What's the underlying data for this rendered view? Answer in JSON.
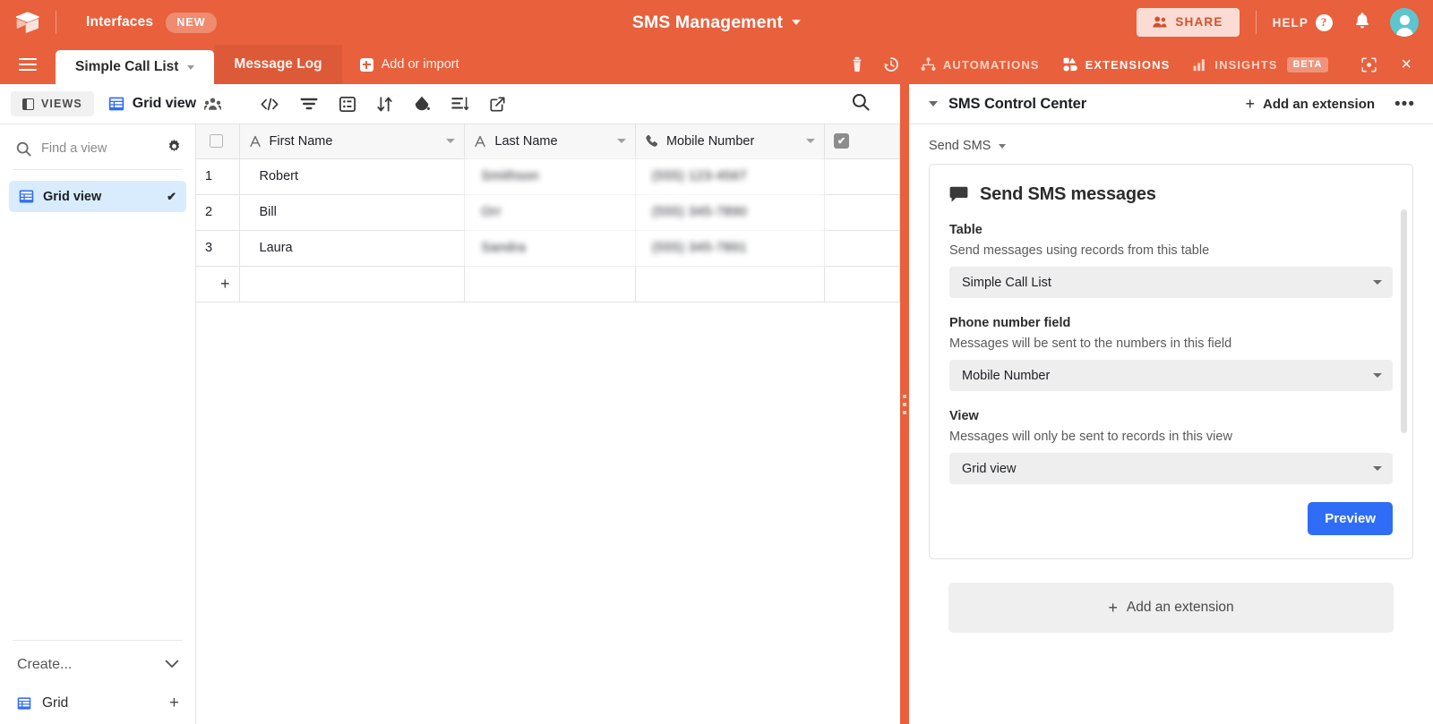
{
  "header": {
    "logo_icon": "airtable-logo-icon",
    "interfaces_label": "Interfaces",
    "new_badge": "NEW",
    "base_title": "SMS Management",
    "share_label": "SHARE",
    "share_icon": "people-share-icon",
    "help_label": "HELP",
    "help_icon": "question-circle-icon",
    "bell_icon": "notification-bell-icon",
    "avatar_icon": "user-avatar-icon",
    "brand_color": "#e8603c"
  },
  "tabs": {
    "menu_icon": "hamburger-menu-icon",
    "items": [
      {
        "label": "Simple Call List",
        "active": true
      },
      {
        "label": "Message Log",
        "active": false
      }
    ],
    "add_label": "Add or import",
    "right_icons": [
      {
        "name": "trash-icon"
      },
      {
        "name": "history-clock-icon"
      }
    ],
    "right_items": [
      {
        "label": "AUTOMATIONS",
        "icon": "automations-icon",
        "active": false
      },
      {
        "label": "EXTENSIONS",
        "icon": "extensions-blocks-icon",
        "active": true
      },
      {
        "label": "INSIGHTS",
        "icon": "insights-bar-icon",
        "active": false,
        "badge": "BETA"
      }
    ],
    "expand_icon": "expand-fullscreen-icon",
    "close_icon": "close-x-icon"
  },
  "viewbar": {
    "views_label": "VIEWS",
    "views_icon": "side-panel-icon",
    "current_view": "Grid view",
    "current_view_icon": "grid-view-icon",
    "collaborators_icon": "collaborators-icon",
    "tools": [
      {
        "name": "embed-code-icon"
      },
      {
        "name": "filter-icon"
      },
      {
        "name": "group-icon"
      },
      {
        "name": "sort-icon"
      },
      {
        "name": "color-fill-icon"
      },
      {
        "name": "row-height-icon"
      },
      {
        "name": "share-view-icon"
      }
    ],
    "search_icon": "search-icon"
  },
  "view_sidebar": {
    "search_placeholder": "Find a view",
    "search_icon": "search-icon",
    "gear_icon": "gear-icon",
    "views": [
      {
        "label": "Grid view",
        "icon": "grid-view-icon",
        "selected": true,
        "check": "✔"
      }
    ],
    "create_label": "Create...",
    "create_chevron_icon": "chevron-down-icon",
    "create_items": [
      {
        "label": "Grid",
        "icon": "grid-view-icon",
        "plus": "+"
      }
    ]
  },
  "grid": {
    "columns": [
      {
        "label": "First Name",
        "type_icon": "text-field-icon"
      },
      {
        "label": "Last Name",
        "type_icon": "text-field-icon"
      },
      {
        "label": "Mobile Number",
        "type_icon": "phone-field-icon"
      },
      {
        "label": "",
        "type_icon": "checkbox-field-icon"
      }
    ],
    "rows": [
      {
        "num": "1",
        "first_name": "Robert",
        "last_name": "Smithson",
        "mobile": "(555) 123-4567"
      },
      {
        "num": "2",
        "first_name": "Bill",
        "last_name": "Orr",
        "mobile": "(555) 345-7890"
      },
      {
        "num": "3",
        "first_name": "Laura",
        "last_name": "Sandra",
        "mobile": "(555) 345-7891"
      }
    ],
    "add_row_label": "+"
  },
  "extension_panel": {
    "collapse_icon": "caret-down-icon",
    "title": "SMS Control Center",
    "add_extension_label": "Add an extension",
    "add_extension_icon": "plus-icon",
    "more_icon": "ellipsis-icon",
    "dropdown_label": "Send SMS",
    "card": {
      "icon": "chat-bubble-icon",
      "title": "Send SMS messages",
      "fields": [
        {
          "label": "Table",
          "help": "Send messages using records from this table",
          "value": "Simple Call List"
        },
        {
          "label": "Phone number field",
          "help": "Messages will be sent to the numbers in this field",
          "value": "Mobile Number"
        },
        {
          "label": "View",
          "help": "Messages will only be sent to records in this view",
          "value": "Grid view"
        }
      ],
      "preview_button": "Preview",
      "preview_color": "#2f6df6"
    },
    "add_bottom_label": "Add an extension",
    "add_bottom_icon": "plus-icon"
  }
}
